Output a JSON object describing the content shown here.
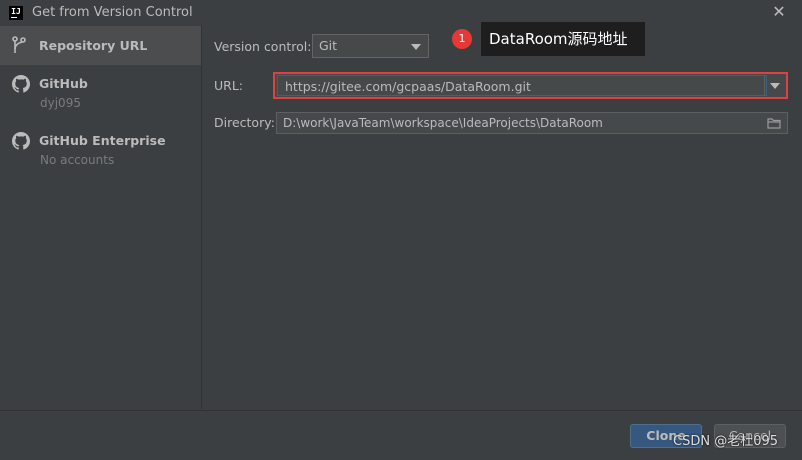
{
  "window": {
    "title": "Get from Version Control"
  },
  "sidebar": {
    "items": [
      {
        "label": "Repository URL",
        "sub": ""
      },
      {
        "label": "GitHub",
        "sub": "dyj095"
      },
      {
        "label": "GitHub Enterprise",
        "sub": "No accounts"
      }
    ]
  },
  "form": {
    "vcs_label": "Version control:",
    "vcs_value": "Git",
    "url_label": "URL:",
    "url_value": "https://gitee.com/gcpaas/DataRoom.git",
    "dir_label": "Directory:",
    "dir_value": "D:\\work\\JavaTeam\\workspace\\IdeaProjects\\DataRoom"
  },
  "annotation": {
    "badge": "1",
    "text": "DataRoom源码地址"
  },
  "footer": {
    "clone_label": "Clone",
    "cancel_label": "Cancel"
  },
  "watermark": "CSDN @老杜095"
}
